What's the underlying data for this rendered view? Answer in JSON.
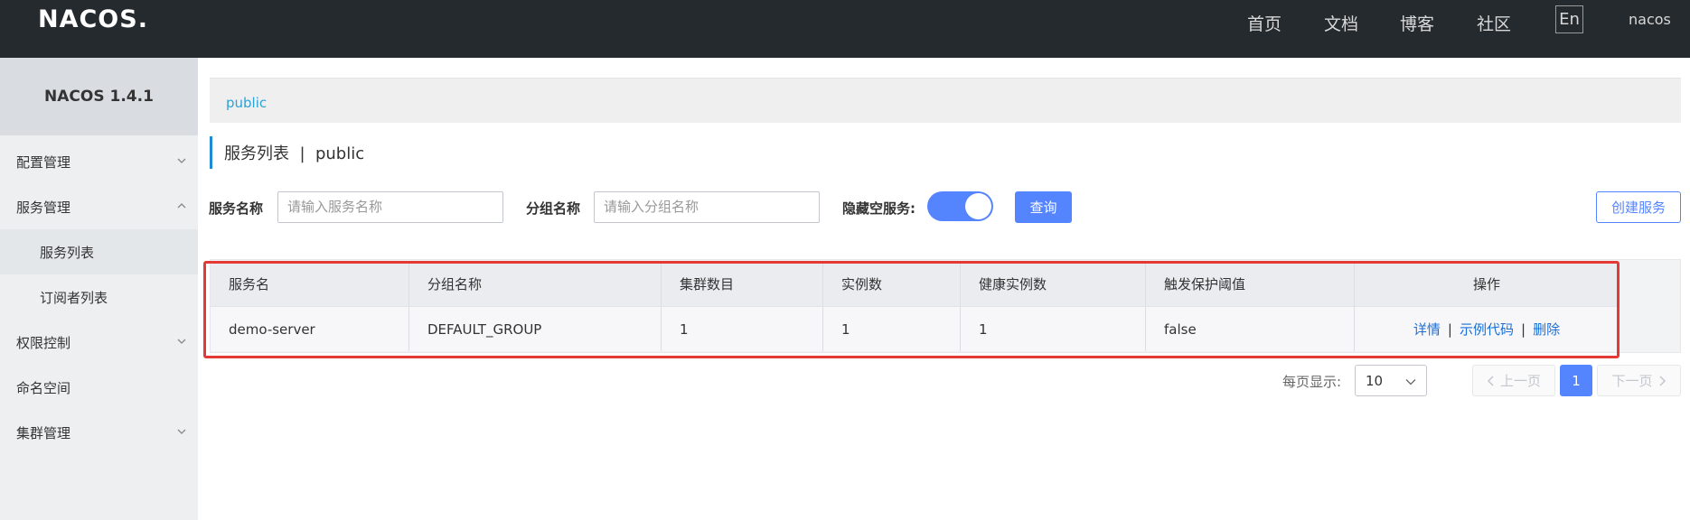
{
  "header": {
    "logo_text": "NACOS",
    "nav": [
      "首页",
      "文档",
      "博客",
      "社区"
    ],
    "lang": "En",
    "user": "nacos"
  },
  "sidebar": {
    "version": "NACOS 1.4.1",
    "items": [
      {
        "label": "配置管理",
        "icon": "chevron-down-icon"
      },
      {
        "label": "服务管理",
        "icon": "chevron-up-icon"
      },
      {
        "label": "服务列表"
      },
      {
        "label": "订阅者列表"
      },
      {
        "label": "权限控制",
        "icon": "chevron-down-icon"
      },
      {
        "label": "命名空间"
      },
      {
        "label": "集群管理",
        "icon": "chevron-down-icon"
      }
    ]
  },
  "breadcrumb": "public",
  "page_title": "服务列表  |  public",
  "filters": {
    "service_name_label": "服务名称",
    "service_name_placeholder": "请输入服务名称",
    "group_name_label": "分组名称",
    "group_name_placeholder": "请输入分组名称",
    "hide_empty_label": "隐藏空服务:",
    "hide_empty_on": true,
    "query_label": "查询",
    "create_label": "创建服务"
  },
  "table": {
    "columns": [
      "服务名",
      "分组名称",
      "集群数目",
      "实例数",
      "健康实例数",
      "触发保护阈值",
      "操作"
    ],
    "rows": [
      {
        "service": "demo-server",
        "group": "DEFAULT_GROUP",
        "clusters": "1",
        "instances": "1",
        "healthy": "1",
        "threshold": "false",
        "actions": [
          "详情",
          "示例代码",
          "删除"
        ]
      }
    ]
  },
  "pagination": {
    "page_size_label": "每页显示:",
    "page_size": "10",
    "prev": "上一页",
    "current": "1",
    "next": "下一页"
  },
  "colors": {
    "accent": "#5584ff",
    "header_bg": "#252a2f",
    "highlight": "#e53935"
  }
}
